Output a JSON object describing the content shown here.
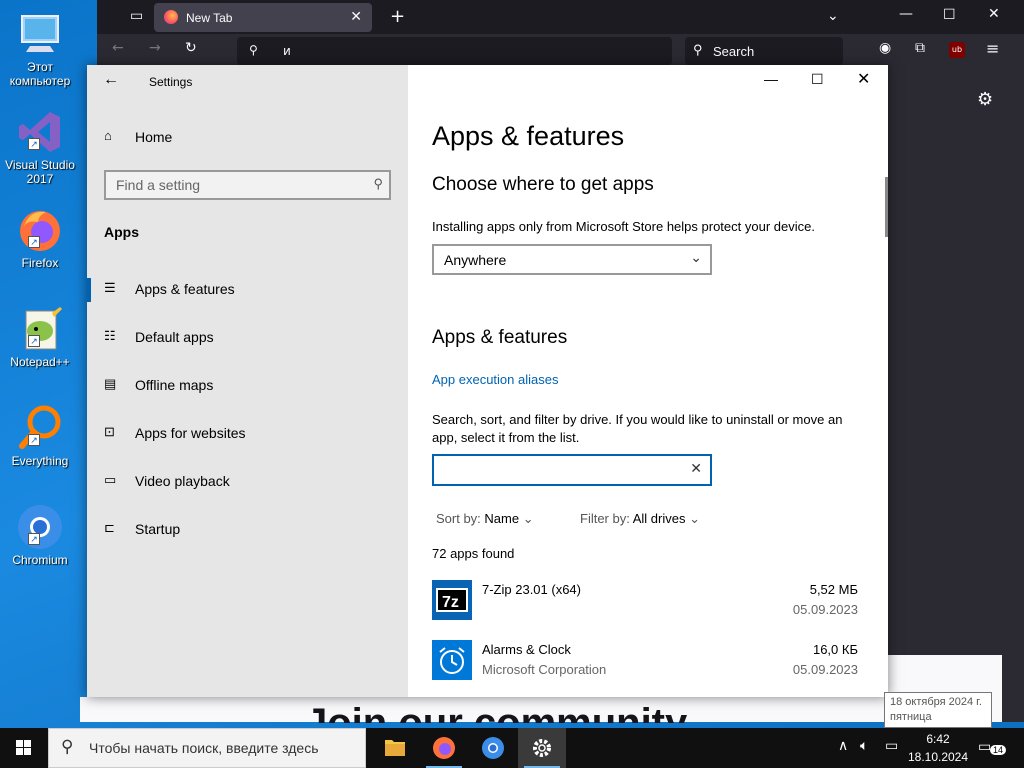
{
  "desktop": {
    "icons": [
      {
        "label": "Этот компьютер"
      },
      {
        "label": "Visual Studio 2017"
      },
      {
        "label": "Firefox"
      },
      {
        "label": "Notepad++"
      },
      {
        "label": "Everything"
      },
      {
        "label": "Chromium"
      }
    ]
  },
  "browser": {
    "tab_title": "New Tab",
    "url_text": "и",
    "search_placeholder": "Search",
    "page_heading": "Join our community"
  },
  "settings": {
    "window_title": "Settings",
    "home_label": "Home",
    "find_placeholder": "Find a setting",
    "section": "Apps",
    "nav": [
      {
        "label": "Apps & features",
        "active": true
      },
      {
        "label": "Default apps"
      },
      {
        "label": "Offline maps"
      },
      {
        "label": "Apps for websites"
      },
      {
        "label": "Video playback"
      },
      {
        "label": "Startup"
      }
    ],
    "main": {
      "title": "Apps & features",
      "choose_heading": "Choose where to get apps",
      "choose_desc": "Installing apps only from Microsoft Store helps protect your device.",
      "source_value": "Anywhere",
      "features_heading": "Apps & features",
      "aliases_link": "App execution aliases",
      "search_desc": "Search, sort, and filter by drive. If you would like to uninstall or move an app, select it from the list.",
      "sort_label": "Sort by:",
      "sort_value": "Name",
      "filter_label": "Filter by:",
      "filter_value": "All drives",
      "count_text": "72 apps found",
      "apps": [
        {
          "name": "7-Zip 23.01 (x64)",
          "publisher": "",
          "size": "5,52 МБ",
          "date": "05.09.2023"
        },
        {
          "name": "Alarms & Clock",
          "publisher": "Microsoft Corporation",
          "size": "16,0 КБ",
          "date": "05.09.2023"
        }
      ]
    }
  },
  "taskbar": {
    "search_placeholder": "Чтобы начать поиск, введите здесь",
    "time": "6:42",
    "date": "18.10.2024",
    "tooltip_line1": "18 октября 2024 г.",
    "tooltip_line2": "пятница",
    "notification_count": "14"
  }
}
